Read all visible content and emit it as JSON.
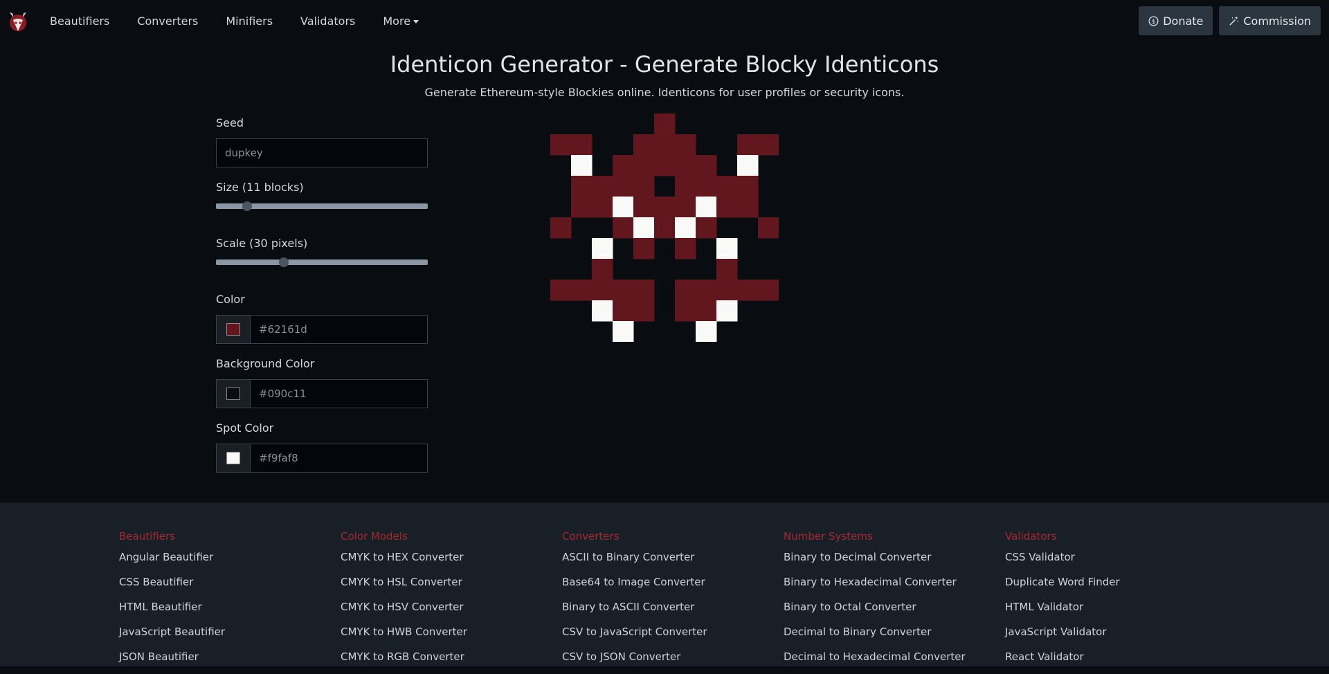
{
  "nav": {
    "links": [
      "Beautifiers",
      "Converters",
      "Minifiers",
      "Validators",
      "More"
    ],
    "donate_label": "Donate",
    "commission_label": "Commission"
  },
  "page": {
    "title": "Identicon Generator - Generate Blocky Identicons",
    "subtitle": "Generate Ethereum-style Blockies online. Identicons for user profiles or security icons."
  },
  "form": {
    "seed_label": "Seed",
    "seed_value": "dupkey",
    "size_label": "Size (11 blocks)",
    "size_fraction": 0.13,
    "scale_label": "Scale (30 pixels)",
    "scale_fraction": 0.31,
    "color_label": "Color",
    "color_value": "#62161d",
    "bg_label": "Background Color",
    "bg_value": "#090c11",
    "spot_label": "Spot Color",
    "spot_value": "#f9faf8"
  },
  "identicon": {
    "grid": [
      "00000100000",
      "11001110011",
      "02011111020",
      "01111011110",
      "01121112110",
      "10012121001",
      "00201010200",
      "00100000100",
      "11111011111",
      "00211011200",
      "00020002000"
    ]
  },
  "footer": {
    "columns": [
      {
        "heading": "Beautifiers",
        "links": [
          "Angular Beautifier",
          "CSS Beautifier",
          "HTML Beautifier",
          "JavaScript Beautifier",
          "JSON Beautifier"
        ]
      },
      {
        "heading": "Color Models",
        "links": [
          "CMYK to HEX Converter",
          "CMYK to HSL Converter",
          "CMYK to HSV Converter",
          "CMYK to HWB Converter",
          "CMYK to RGB Converter"
        ]
      },
      {
        "heading": "Converters",
        "links": [
          "ASCII to Binary Converter",
          "Base64 to Image Converter",
          "Binary to ASCII Converter",
          "CSV to JavaScript Converter",
          "CSV to JSON Converter"
        ]
      },
      {
        "heading": "Number Systems",
        "links": [
          "Binary to Decimal Converter",
          "Binary to Hexadecimal Converter",
          "Binary to Octal Converter",
          "Decimal to Binary Converter",
          "Decimal to Hexadecimal Converter"
        ]
      },
      {
        "heading": "Validators",
        "links": [
          "CSS Validator",
          "Duplicate Word Finder",
          "HTML Validator",
          "JavaScript Validator",
          "React Validator"
        ]
      }
    ]
  }
}
